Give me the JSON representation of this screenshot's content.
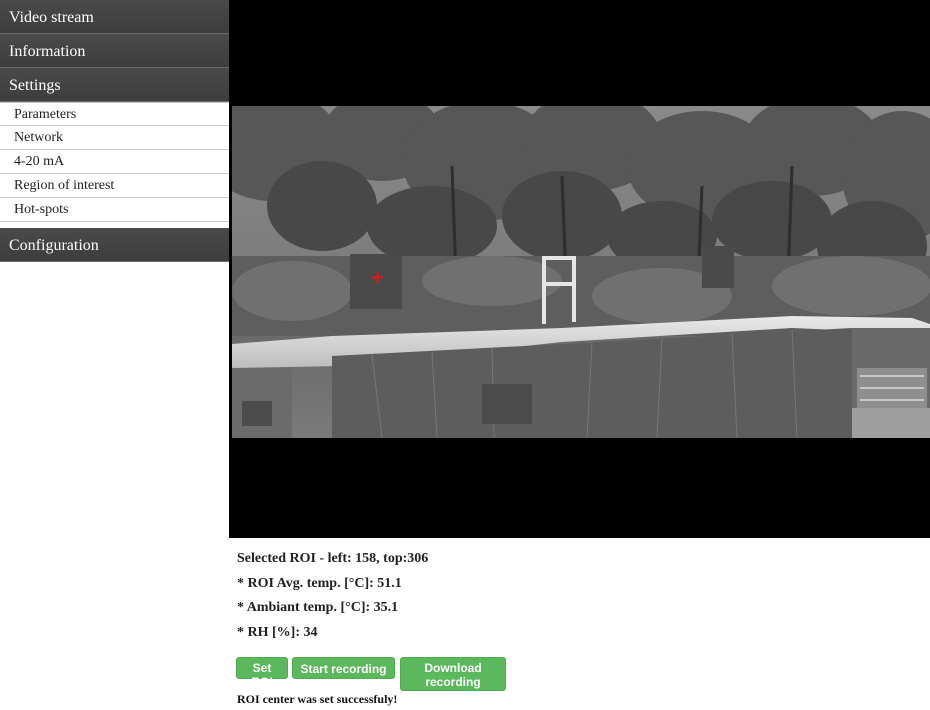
{
  "sidebar": {
    "sections": [
      {
        "label": "Video stream"
      },
      {
        "label": "Information"
      },
      {
        "label": "Settings"
      }
    ],
    "settings_items": [
      {
        "label": "Parameters"
      },
      {
        "label": "Network"
      },
      {
        "label": "4-20 mA"
      },
      {
        "label": "Region of interest"
      },
      {
        "label": "Hot-spots"
      }
    ],
    "configuration": {
      "label": "Configuration"
    }
  },
  "video": {
    "roi_marker": "+"
  },
  "readouts": {
    "selected_roi": "Selected ROI - left: 158, top:306",
    "roi_avg_temp": "* ROI Avg. temp. [°C]: 51.1",
    "ambient_temp": "* Ambiant temp. [°C]: 35.1",
    "rh": "* RH [%]: 34"
  },
  "buttons": {
    "set_roi": "Set ROI",
    "start_recording": "Start recording",
    "download_line1": "Download",
    "download_line2": "recording"
  },
  "status": "ROI center was set successfuly!",
  "colors": {
    "nav_header": "#444444",
    "button_green": "#5cb85c",
    "roi_marker": "#e01818"
  }
}
